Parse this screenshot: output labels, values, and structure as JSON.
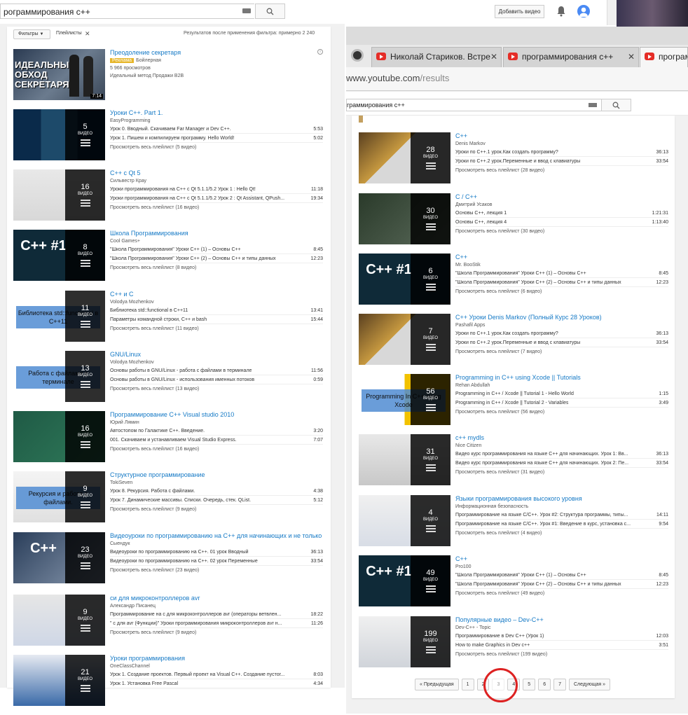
{
  "left": {
    "search_value": "рограммирования с++",
    "upload_label": "Добавить видео",
    "filters_label": "Фильтры",
    "playlists_label": "Плейлисты",
    "results_count": "Результатов после применения фильтра: примерно 2 240",
    "ad": {
      "title": "Преодоление секретаря",
      "badge": "Реклама",
      "channel": "Бойлерная",
      "views": "5 966 просмотров",
      "desc": "Идеальный метод Продажи B2B",
      "duration": "7:14",
      "thumb_text": "ИДЕАЛЬНЫЙ ОБХОД СЕКРЕТАРЯ"
    },
    "items": [
      {
        "title": "Уроки C++. Part 1.",
        "channel": "EasyProgramming",
        "count": "5",
        "videos_label": "ВИДЕО",
        "rows": [
          [
            "Урок 0. Вводный. Скачиваем Far Manager и Dev C++.",
            "5:53"
          ],
          [
            "Урок 1. Пишем и компилируем программу. Hello World!",
            "5:02"
          ]
        ],
        "all": "Просмотреть весь плейлист (5 видео)"
      },
      {
        "title": "C++ с Qt 5",
        "channel": "Сильвестр Крау",
        "count": "16",
        "videos_label": "ВИДЕО",
        "rows": [
          [
            "Уроки программирования на C++ с Qt 5.1.1/5.2 Урок 1 : Hello Qt!",
            "11:18"
          ],
          [
            "Уроки программирования на C++ с Qt 5.1.1/5.2 Урок 2 : Qt Assistant, QPush...",
            "19:34"
          ]
        ],
        "all": "Просмотреть весь плейлист (16 видео)"
      },
      {
        "title": "Школа Программирования",
        "channel": "Cool Games+",
        "count": "8",
        "videos_label": "ВИДЕО",
        "rows": [
          [
            "\"Школа Программирования\" Уроки C++ (1) – Основы C++",
            "8:45"
          ],
          [
            "\"Школа Программирования\" Уроки C++ (2) – Основы C++ и типы данных",
            "12:23"
          ]
        ],
        "all": "Просмотреть весь плейлист (8 видео)",
        "thumb_text": "C++ #1"
      },
      {
        "title": "C++ и C",
        "channel": "Volodya Mozhenkov",
        "count": "11",
        "videos_label": "ВИДЕО",
        "rows": [
          [
            "Библиотека std::functional в C++11",
            "13:41"
          ],
          [
            "Параметры командной строки, C++ и bash",
            "15:44"
          ]
        ],
        "all": "Просмотреть весь плейлист (11 видео)",
        "thumb_text": "Библиотека std::functional в C++11"
      },
      {
        "title": "GNU/Linux",
        "channel": "Volodya Mozhenkov",
        "count": "13",
        "videos_label": "ВИДЕО",
        "rows": [
          [
            "Основы работы в GNU/Linux - работа с файлами в терминале",
            "11:56"
          ],
          [
            "Основы работы в GNU/Linux - использования именных потоков",
            "0:59"
          ]
        ],
        "all": "Просмотреть весь плейлист (13 видео)",
        "thumb_text": "Работа с файлами в терминале"
      },
      {
        "title": "Программирование C++ Visual studio 2010",
        "channel": "Юрий Лямин",
        "count": "16",
        "videos_label": "ВИДЕО",
        "rows": [
          [
            "Автостопом по Галактике C++. Введение.",
            "3:20"
          ],
          [
            "001. Скачиваем и устанавливаем Visual Studio Express.",
            "7:07"
          ]
        ],
        "all": "Просмотреть весь плейлист (16 видео)"
      },
      {
        "title": "Структурное программирование",
        "channel": "TokiSeven",
        "count": "9",
        "videos_label": "ВИДЕО",
        "rows": [
          [
            "Урок 8. Рекурсия. Работа с файлами.",
            "4:38"
          ],
          [
            "Урок 7. Динамические массивы. Списки. Очередь, стек. QList.",
            "5:12"
          ]
        ],
        "all": "Просмотреть весь плейлист (9 видео)",
        "thumb_text": "Рекурсия и работа с файлами."
      },
      {
        "title": "Видеоуроки по программированию на C++ для начинающих и не только",
        "channel": "Сыендук",
        "count": "23",
        "videos_label": "ВИДЕО",
        "rows": [
          [
            "Видеоуроки по программированию на C++. 01 урок Вводный",
            "36:13"
          ],
          [
            "Видеоуроки по программированию на C++. 02 урок Переменные",
            "33:54"
          ]
        ],
        "all": "Просмотреть весь плейлист (23 видео)",
        "thumb_text": "C++"
      },
      {
        "title": "си для микроконтроллеров avr",
        "channel": "Александр Писанец",
        "count": "9",
        "videos_label": "ВИДЕО",
        "rows": [
          [
            "Программирование на с для микроконтроллеров avr (операторы ветвлен...",
            "18:22"
          ],
          [
            "\" с для avr (Функции)\" Уроки программирования микроконтроллеров avr н...",
            "11:26"
          ]
        ],
        "all": "Просмотреть весь плейлист (9 видео)"
      },
      {
        "title": "Уроки программирования",
        "channel": "OneClassChannel",
        "count": "21",
        "videos_label": "ВИДЕО",
        "rows": [
          [
            "Урок 1. Создание проектов. Первый проект на Visual C++. Создание пустог...",
            "8:03"
          ],
          [
            "Урок 1. Установка Free Pascal",
            "4:34"
          ]
        ],
        "all": ""
      }
    ]
  },
  "right": {
    "tabs": [
      {
        "label": "Николай Стариков. Встре"
      },
      {
        "label": "программирования с++"
      },
      {
        "label": "программ"
      }
    ],
    "url_host": "www.youtube.com",
    "url_path": "/results",
    "search_value": "граммирования с++",
    "items": [
      {
        "title": "C++",
        "channel": "Denis Markov",
        "count": "28",
        "videos_label": "ВИДЕО",
        "rows": [
          [
            "Уроки по C++.1 урок.Как создать программу?",
            "36:13"
          ],
          [
            "Уроки по C++.2 урок.Переменные и ввод с клавиатуры",
            "33:54"
          ]
        ],
        "all": "Просмотреть весь плейлист (28 видео)"
      },
      {
        "title": "C / C++",
        "channel": "Дмитрий Усаков",
        "count": "30",
        "videos_label": "ВИДЕО",
        "rows": [
          [
            "Основы C++, лекция 1",
            "1:21:31"
          ],
          [
            "Основы C++, лекция 4",
            "1:13:40"
          ]
        ],
        "all": "Просмотреть весь плейлист (30 видео)"
      },
      {
        "title": "C++",
        "channel": "Mr. BooStik",
        "count": "6",
        "videos_label": "ВИДЕО",
        "rows": [
          [
            "\"Школа Программирования\" Уроки C++ (1) – Основы C++",
            "8:45"
          ],
          [
            "\"Школа Программирования\" Уроки C++ (2) – Основы C++ и типы данных",
            "12:23"
          ]
        ],
        "all": "Просмотреть весь плейлист (6 видео)",
        "thumb_text": "C++ #1"
      },
      {
        "title": "C++ Уроки Denis Markov (Полный Курс 28 Уроков)",
        "channel": "Pashafil Apps",
        "count": "7",
        "videos_label": "ВИДЕО",
        "rows": [
          [
            "Уроки по C++.1 урок.Как создать программу?",
            "36:13"
          ],
          [
            "Уроки по C++.2 урок.Переменные и ввод с клавиатуры",
            "33:54"
          ]
        ],
        "all": "Просмотреть весь плейлист (7 видео)"
      },
      {
        "title": "Programming in C++ using Xcode || Tutorials",
        "channel": "Rehan Abdullah",
        "count": "56",
        "videos_label": "ВИДЕО",
        "rows": [
          [
            "Programming in C++ / Xcode || Tutorial 1 - Hello World",
            "1:15"
          ],
          [
            "Programming in C++ / Xcode || Tutorial 2 - Variables",
            "3:49"
          ]
        ],
        "all": "Просмотреть весь плейлист (56 видео)",
        "thumb_text": "Programming In C++ using Xcode"
      },
      {
        "title": "c++ mydls",
        "channel": "Nice Citizen",
        "count": "31",
        "videos_label": "ВИДЕО",
        "rows": [
          [
            "Видео курс программирования на языке C++ для начинающих. Урок 1: Вв...",
            "36:13"
          ],
          [
            "Видео курс программирования на языке C++ для начинающих. Урок 2: Пе...",
            "33:54"
          ]
        ],
        "all": "Просмотреть весь плейлист (31 видео)"
      },
      {
        "title": "Языки программирования высокого уровня",
        "channel": "Информационная безопасность",
        "count": "4",
        "videos_label": "ВИДЕО",
        "rows": [
          [
            "Программирование на языке C/C++. Урок #2: Структура программы, типы...",
            "14:11"
          ],
          [
            "Программирование на языке C/C++. Урок #1: Введение в курс, установка с...",
            "9:54"
          ]
        ],
        "all": "Просмотреть весь плейлист (4 видео)"
      },
      {
        "title": "C++",
        "channel": "Pro100",
        "count": "49",
        "videos_label": "ВИДЕО",
        "rows": [
          [
            "\"Школа Программирования\" Уроки C++ (1) – Основы C++",
            "8:45"
          ],
          [
            "\"Школа Программирования\" Уроки C++ (2) – Основы C++ и типы данных",
            "12:23"
          ]
        ],
        "all": "Просмотреть весь плейлист (49 видео)",
        "thumb_text": "C++ #1"
      },
      {
        "title": "Популярные видео – Dev-C++",
        "channel": "Dev-C++ - Topic",
        "count": "199",
        "videos_label": "ВИДЕО",
        "rows": [
          [
            "Программирование в Dev C++ (Урок 1)",
            "12:03"
          ],
          [
            "How to make Graphics in Dev c++",
            "3:51"
          ]
        ],
        "all": "Просмотреть весь плейлист (199 видео)"
      }
    ],
    "pager": {
      "prev": "« Предыдущая",
      "pages": [
        "1",
        "2",
        "3",
        "4",
        "5",
        "6",
        "7"
      ],
      "next": "Следующая »",
      "current": "3"
    }
  },
  "colors": {
    "link": "#167ac6",
    "ad_badge": "#e6b62a",
    "circle": "#dd2222",
    "yt_red": "#e52d27"
  }
}
